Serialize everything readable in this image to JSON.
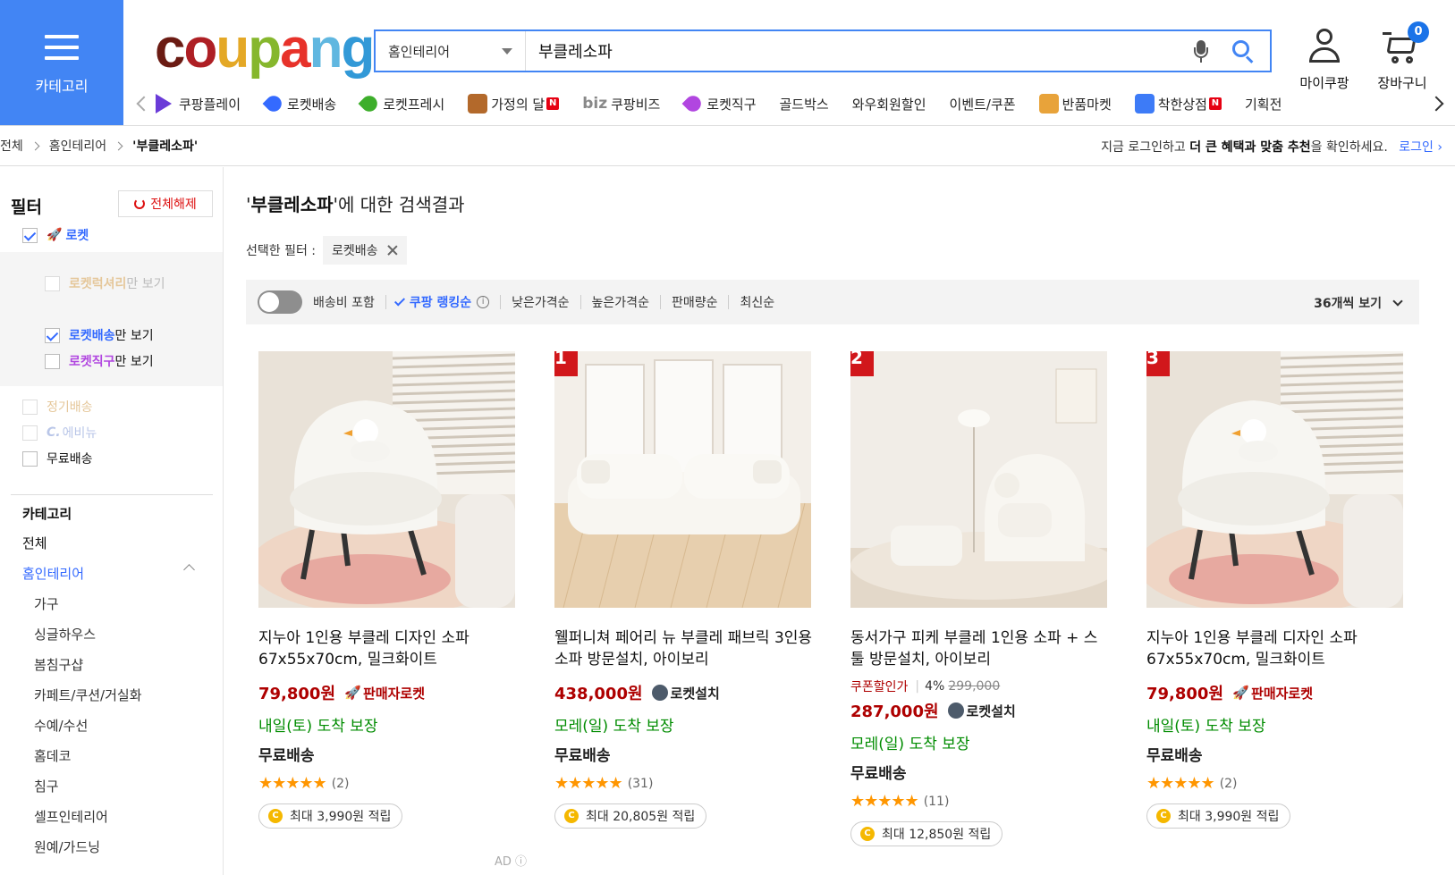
{
  "header": {
    "category_label": "카테고리",
    "logo_letters": [
      "c",
      "o",
      "u",
      "p",
      "a",
      "n",
      "g"
    ],
    "logo_colors": [
      "#6b1b13",
      "#ae1f24",
      "#e4a826",
      "#86b72d",
      "#e7322a",
      "#60b7e0",
      "#3299d7"
    ],
    "search_category": "홈인테리어",
    "search_value": "부클레소파",
    "mycoupang_label": "마이쿠팡",
    "cart_label": "장바구니",
    "cart_count": "0"
  },
  "nav": {
    "items": [
      {
        "label": "쿠팡플레이",
        "icon": "play-icon",
        "color": "#6a3bd8",
        "new": false
      },
      {
        "label": "로켓배송",
        "icon": "rocket-icon",
        "color": "#346aff",
        "new": false
      },
      {
        "label": "로켓프레시",
        "icon": "rocket-fresh-icon",
        "color": "#3dae2b",
        "new": false
      },
      {
        "label": "가정의 달",
        "icon": "bear-icon",
        "color": "#b3692b",
        "new": true
      },
      {
        "label": "쿠팡비즈",
        "icon": "biz-icon",
        "color": "#346aff",
        "new": false,
        "prefix": "biz"
      },
      {
        "label": "로켓직구",
        "icon": "rocket-global-icon",
        "color": "#b146e0",
        "new": false
      },
      {
        "label": "골드박스",
        "icon": "",
        "color": "",
        "new": false
      },
      {
        "label": "와우회원할인",
        "icon": "",
        "color": "",
        "new": false
      },
      {
        "label": "이벤트/쿠폰",
        "icon": "",
        "color": "",
        "new": false
      },
      {
        "label": "반품마켓",
        "icon": "return-market-icon",
        "color": "#e8a33a",
        "new": false
      },
      {
        "label": "착한상점",
        "icon": "good-store-icon",
        "color": "#3d7bf7",
        "new": true
      },
      {
        "label": "기획전",
        "icon": "",
        "color": "",
        "new": false
      }
    ],
    "new_badge": "N"
  },
  "breadcrumb": {
    "items": [
      "전체",
      "홈인테리어"
    ],
    "current": "'부클레소파'",
    "login_msg_1": "지금 로그인하고 ",
    "login_msg_bold": "더 큰 혜택과 맞춤 추천",
    "login_msg_2": "을 확인하세요.",
    "login_link": "로그인"
  },
  "sidebar": {
    "filter_title": "필터",
    "reset_label": "전체해제",
    "rocket_label": "로켓",
    "rocket_luxury": "로켓럭셔리",
    "only_view": "만 보기",
    "rocket_delivery": "로켓배송",
    "rocket_global": "로켓직구",
    "subscription": "정기배송",
    "c_eco": "에비뉴",
    "free_shipping": "무료배송",
    "category_head": "카테고리",
    "cat_all": "전체",
    "cat_home": "홈인테리어",
    "subcats": [
      "가구",
      "싱글하우스",
      "봄침구샵",
      "카페트/쿠션/거실화",
      "수예/수선",
      "홈데코",
      "침구",
      "셀프인테리어",
      "원예/가드닝"
    ]
  },
  "main": {
    "query": "부클레소파",
    "result_suffix": "'에 대한 검색결과",
    "selected_filter_label": "선택한 필터 :",
    "selected_filter_chip": "로켓배송",
    "sort": {
      "shipping_label": "배송비 포함",
      "rank_label": "쿠팡 랭킹순",
      "low_price": "낮은가격순",
      "high_price": "높은가격순",
      "sales": "판매량순",
      "latest": "최신순",
      "per_page": "36개씩 보기"
    },
    "ad_label": "AD"
  },
  "products": [
    {
      "rank": "",
      "name": "지누아 1인용 부클레 디자인 소파 67x55x70cm, 밀크화이트",
      "price": "79,800원",
      "badge": "판매자로켓",
      "badge_type": "seller",
      "coupon_label": "",
      "coupon_pct": "",
      "orig_price": "",
      "delivery": "내일(토) 도착 보장",
      "free": "무료배송",
      "stars": "★★★★★",
      "reviews": "(2)",
      "reward": "최대 3,990원 적립"
    },
    {
      "rank": "1",
      "name": "웰퍼니쳐 페어리 뉴 부클레 패브릭 3인용 소파 방문설치, 아이보리",
      "price": "438,000원",
      "badge": "로켓설치",
      "badge_type": "install",
      "coupon_label": "",
      "coupon_pct": "",
      "orig_price": "",
      "delivery": "모레(일) 도착 보장",
      "free": "무료배송",
      "stars": "★★★★★",
      "reviews": "(31)",
      "reward": "최대 20,805원 적립"
    },
    {
      "rank": "2",
      "name": "동서가구 피케 부클레 1인용 소파 + 스툴 방문설치, 아이보리",
      "price": "287,000원",
      "badge": "로켓설치",
      "badge_type": "install",
      "coupon_label": "쿠폰할인가",
      "coupon_pct": "4%",
      "orig_price": "299,000",
      "delivery": "모레(일) 도착 보장",
      "free": "무료배송",
      "stars": "★★★★★",
      "reviews": "(11)",
      "reward": "최대 12,850원 적립"
    },
    {
      "rank": "3",
      "name": "지누아 1인용 부클레 디자인 소파 67x55x70cm, 밀크화이트",
      "price": "79,800원",
      "badge": "판매자로켓",
      "badge_type": "seller",
      "coupon_label": "",
      "coupon_pct": "",
      "orig_price": "",
      "delivery": "내일(토) 도착 보장",
      "free": "무료배송",
      "stars": "★★★★★",
      "reviews": "(2)",
      "reward": "최대 3,990원 적립"
    }
  ]
}
